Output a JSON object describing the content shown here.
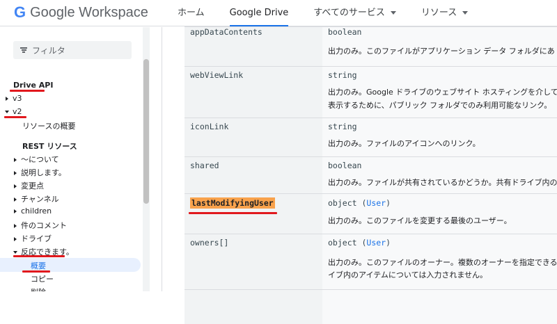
{
  "header": {
    "logo_g": "G",
    "logo_text": "Google Workspace",
    "nav": [
      {
        "label": "ホーム",
        "active": false
      },
      {
        "label": "Google Drive",
        "active": true
      },
      {
        "label": "すべてのサービス",
        "active": false
      },
      {
        "label": "リソース",
        "active": false
      }
    ]
  },
  "sidebar": {
    "filter_placeholder": "フィルタ",
    "items": {
      "drive_api": "Drive API",
      "v3": "v3",
      "v2": "v2",
      "resource_overview": "リソースの概要",
      "rest_resources": "REST リソース",
      "about": "〜について",
      "explain": "説明します。",
      "changes": "変更点",
      "channels": "チャンネル",
      "children": "children",
      "comments": "件のコメント",
      "drives": "ドライブ",
      "replies": "反応できます。",
      "overview": "概要",
      "copy": "コピー",
      "delete": "削除"
    }
  },
  "table": {
    "rows": [
      {
        "name": "appDataContents",
        "type": "boolean",
        "type_link": "",
        "desc": [
          "出力のみ。このファイルがアプリケーション データ フォルダにあ"
        ]
      },
      {
        "name": "webViewLink",
        "type": "string",
        "type_link": "",
        "desc": [
          "出力のみ。Google ドライブのウェブサイト ホスティングを介して",
          "表示するために、パブリック フォルダでのみ利用可能なリンク。"
        ]
      },
      {
        "name": "iconLink",
        "type": "string",
        "type_link": "",
        "desc": [
          "出力のみ。ファイルのアイコンへのリンク。"
        ]
      },
      {
        "name": "shared",
        "type": "boolean",
        "type_link": "",
        "desc": [
          "出力のみ。ファイルが共有されているかどうか。共有ドライブ内の"
        ]
      },
      {
        "name": "lastModifyingUser",
        "type": "object (",
        "type_link": "User",
        "type_end": ")",
        "desc": [
          "出力のみ。このファイルを変更する最後のユーザー。"
        ]
      },
      {
        "name": "owners[]",
        "type": "object (",
        "type_link": "User",
        "type_end": ")",
        "desc": [
          "出力のみ。このファイルのオーナー。複数のオーナーを指定できる",
          "イブ内のアイテムについては入力されません。"
        ]
      }
    ]
  },
  "colors": {
    "accent": "#1a73e8",
    "annotation_red": "#e1181d",
    "highlight_orange": "#f9a24c"
  }
}
